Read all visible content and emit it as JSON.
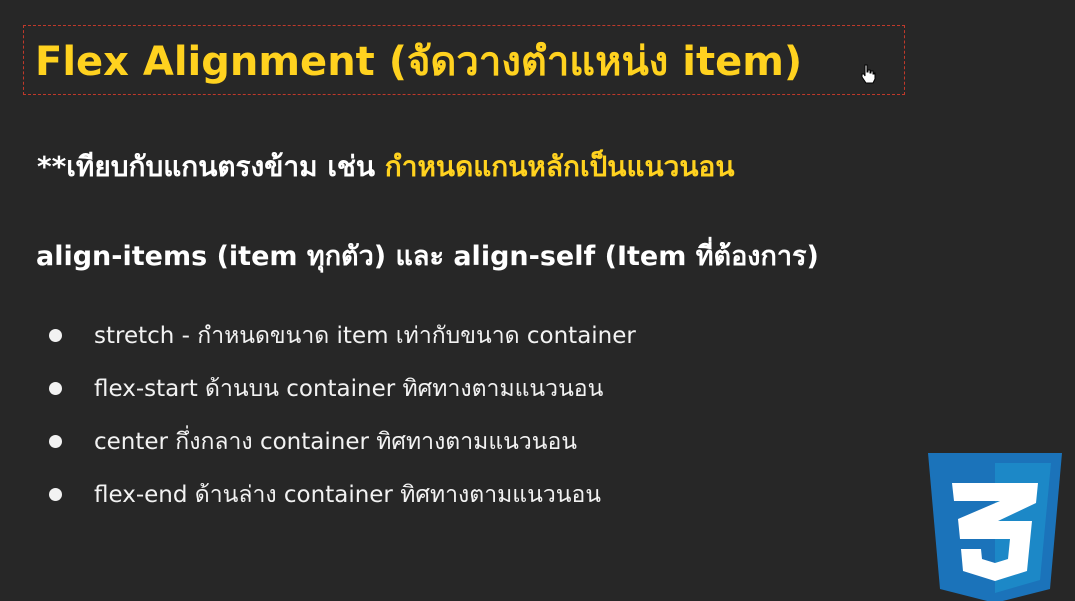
{
  "slide": {
    "title": "Flex Alignment (จัดวางตำแหน่ง item)",
    "subtitle_prefix": "**เทียบกับแกนตรงข้าม เช่น ",
    "subtitle_highlight": "กำหนดแกนหลักเป็นแนวนอน",
    "heading2": "align-items (item ทุกตัว) และ align-self (Item ที่ต้องการ)",
    "bullets": [
      "stretch - กำหนดขนาด item เท่ากับขนาด container",
      "flex-start ด้านบน container ทิศทางตามแนวนอน",
      "center กึ่งกลาง container ทิศทางตามแนวนอน",
      "flex-end ด้านล่าง container ทิศทางตามแนวนอน"
    ],
    "logo_text": "3"
  },
  "colors": {
    "background": "#272727",
    "accent_yellow": "#ffd21f",
    "text": "#ffffff",
    "css_blue_dark": "#1b73ba",
    "css_blue_light": "#1c88c7",
    "title_border": "#c0392b"
  },
  "icons": {
    "cursor": "hand-pointer-icon",
    "logo": "css3-logo-icon"
  }
}
